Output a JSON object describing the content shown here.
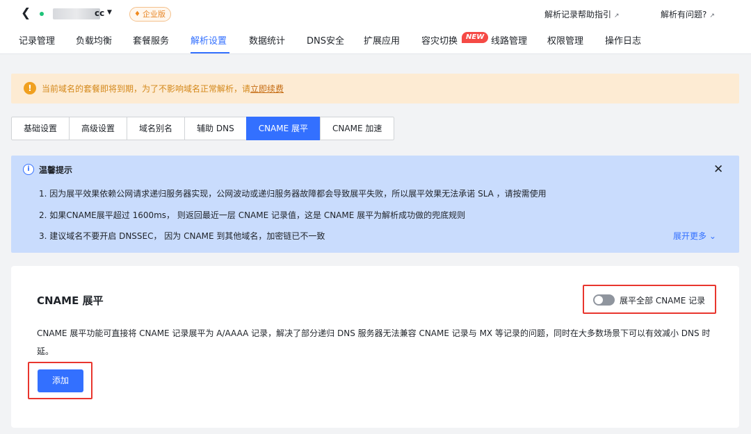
{
  "header": {
    "domain_suffix": "cc",
    "edition_badge": "企业版",
    "help_link": "解析记录帮助指引",
    "issue_link": "解析有问题?",
    "ext_glyph": "↗"
  },
  "nav_tabs": [
    "记录管理",
    "负载均衡",
    "套餐服务",
    "解析设置",
    "数据统计",
    "DNS安全",
    "扩展应用",
    "容灾切换",
    "线路管理",
    "权限管理",
    "操作日志"
  ],
  "nav_active": "解析设置",
  "new_badge": "NEW",
  "warning": {
    "text": "当前域名的套餐即将到期，为了不影响域名正常解析，请",
    "link": "立即续费"
  },
  "segments": [
    "基础设置",
    "高级设置",
    "域名别名",
    "辅助 DNS",
    "CNAME 展平",
    "CNAME 加速"
  ],
  "segment_active": "CNAME 展平",
  "tip": {
    "title": "温馨提示",
    "lines": [
      "1. 因为展平效果依赖公网请求递归服务器实现，公网波动或递归服务器故障都会导致展平失败，所以展平效果无法承诺 SLA ，请按需使用",
      "2. 如果CNAME展平超过 1600ms， 则返回最近一层 CNAME 记录值，这是 CNAME 展平为解析成功做的兜底规则",
      "3. 建议域名不要开启 DNSSEC， 因为 CNAME 到其他域名，加密链已不一致"
    ],
    "more": "展开更多"
  },
  "card": {
    "title": "CNAME 展平",
    "toggle_label": "展平全部 CNAME 记录",
    "toggle_on": false,
    "description": "CNAME 展平功能可直接将 CNAME 记录展平为 A/AAAA 记录，解决了部分递归 DNS 服务器无法兼容 CNAME 记录与 MX 等记录的问题，同时在大多数场景下可以有效减小 DNS 时延。",
    "add_button": "添加"
  },
  "colors": {
    "accent": "#3370ff",
    "warning_bg": "#fdebd3",
    "tip_bg": "#c9dcfd",
    "highlight_red": "#e8352d",
    "new_red": "#f54a45"
  }
}
